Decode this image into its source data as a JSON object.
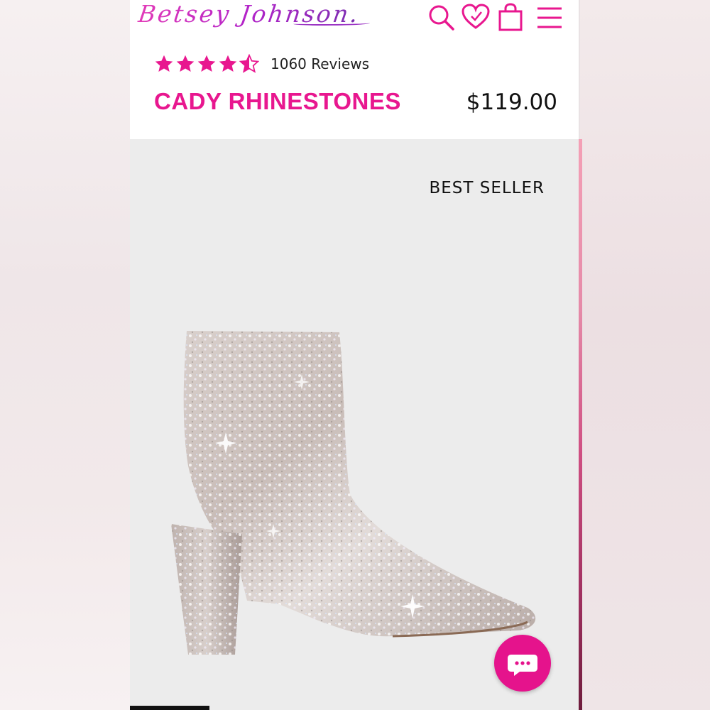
{
  "brand": {
    "logo_text": "Betsey Johnson.",
    "accent_color": "#e8178f"
  },
  "header": {
    "icons": [
      "search-icon",
      "heart-icon",
      "bag-icon",
      "menu-icon"
    ]
  },
  "product": {
    "rating": 4.5,
    "rating_max": 5,
    "reviews_label": "1060 Reviews",
    "name": "CADY RHINESTONES",
    "price": "$119.00",
    "badge": "BEST SELLER"
  },
  "chat": {
    "icon": "chat-icon"
  }
}
